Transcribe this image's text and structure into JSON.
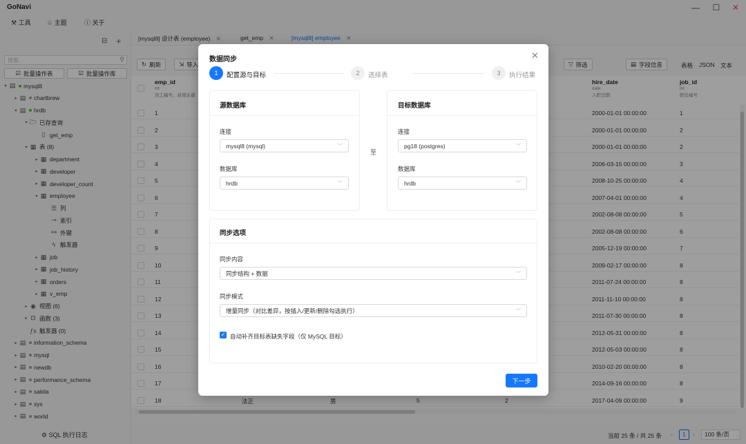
{
  "app": {
    "title": "GoNavi",
    "min": "—",
    "max": "☐",
    "close": "✕"
  },
  "menu": {
    "tools": "工具",
    "theme": "主题",
    "about": "关于"
  },
  "sidebar": {
    "search_placeholder": "搜索...",
    "batch_table": "批量操作表",
    "batch_db": "批量操作库",
    "tree": [
      {
        "label": "mysql8",
        "level": 0,
        "icon": "database-icon",
        "dot": "green",
        "arrow": "▾"
      },
      {
        "label": "chartbrew",
        "level": 1,
        "icon": "database-icon",
        "dot": "grey",
        "arrow": "▸"
      },
      {
        "label": "hrdb",
        "level": 1,
        "icon": "database-icon",
        "dot": "green",
        "arrow": "▾"
      },
      {
        "label": "已存查询",
        "level": 2,
        "icon": "folder-icon",
        "arrow": "▾"
      },
      {
        "label": "get_emp",
        "level": 3,
        "icon": "file-icon",
        "arrow": ""
      },
      {
        "label": "表 (8)",
        "level": 2,
        "icon": "table-icon",
        "arrow": "▾"
      },
      {
        "label": "department",
        "level": 3,
        "icon": "table-icon",
        "arrow": "▸"
      },
      {
        "label": "developer",
        "level": 3,
        "icon": "table-icon",
        "arrow": "▸"
      },
      {
        "label": "developer_count",
        "level": 3,
        "icon": "table-icon",
        "arrow": "▸"
      },
      {
        "label": "employee",
        "level": 3,
        "icon": "table-icon",
        "arrow": "▾"
      },
      {
        "label": "列",
        "level": 4,
        "icon": "list-icon",
        "arrow": ""
      },
      {
        "label": "索引",
        "level": 4,
        "icon": "key-icon",
        "arrow": ""
      },
      {
        "label": "外键",
        "level": 4,
        "icon": "link-icon",
        "arrow": ""
      },
      {
        "label": "触发器",
        "level": 4,
        "icon": "bolt-icon",
        "arrow": ""
      },
      {
        "label": "job",
        "level": 3,
        "icon": "table-icon",
        "arrow": "▸"
      },
      {
        "label": "job_history",
        "level": 3,
        "icon": "table-icon",
        "arrow": "▸"
      },
      {
        "label": "orders",
        "level": 3,
        "icon": "table-icon",
        "arrow": "▸"
      },
      {
        "label": "v_emp",
        "level": 3,
        "icon": "table-icon",
        "arrow": "▸"
      },
      {
        "label": "视图 (6)",
        "level": 2,
        "icon": "eye-icon",
        "arrow": "▸"
      },
      {
        "label": "函数 (3)",
        "level": 2,
        "icon": "function-icon",
        "arrow": "▸"
      },
      {
        "label": "触发器 (0)",
        "level": 2,
        "icon": "fx-icon",
        "arrow": ""
      },
      {
        "label": "information_schema",
        "level": 1,
        "icon": "database-icon",
        "dot": "grey",
        "arrow": "▸"
      },
      {
        "label": "mysql",
        "level": 1,
        "icon": "database-icon",
        "dot": "grey",
        "arrow": "▸"
      },
      {
        "label": "newdb",
        "level": 1,
        "icon": "database-icon",
        "dot": "grey",
        "arrow": "▸"
      },
      {
        "label": "performance_schema",
        "level": 1,
        "icon": "database-icon",
        "dot": "grey",
        "arrow": "▸"
      },
      {
        "label": "sakila",
        "level": 1,
        "icon": "database-icon",
        "dot": "grey",
        "arrow": "▸"
      },
      {
        "label": "sys",
        "level": 1,
        "icon": "database-icon",
        "dot": "grey",
        "arrow": "▸"
      },
      {
        "label": "world",
        "level": 1,
        "icon": "database-icon",
        "dot": "grey",
        "arrow": "▸"
      }
    ],
    "sql_log": "SQL 执行日志"
  },
  "tabs": [
    {
      "label": "[mysql8] 设计表 (employee)",
      "active": false
    },
    {
      "label": "get_emp",
      "active": false
    },
    {
      "label": "[mysql8] employee",
      "active": true
    }
  ],
  "toolbar": {
    "refresh": "刷新",
    "import": "导入",
    "filter": "筛选",
    "field_info": "字段信息",
    "view_table": "表格",
    "view_json": "JSON",
    "view_text": "文本"
  },
  "grid": {
    "col_emp_id": {
      "name": "emp_id",
      "type": "int",
      "comment": "员工编号，自增主键"
    },
    "col_hire_date": {
      "name": "hire_date",
      "type": "date",
      "comment": "入职日期"
    },
    "col_job_id": {
      "name": "job_id",
      "type": "int",
      "comment": "职位编号"
    },
    "rows": [
      {
        "id": "1",
        "hire": "2000-01-01 00:00:00",
        "job": "1"
      },
      {
        "id": "2",
        "hire": "2000-01-01 00:00:00",
        "job": "2"
      },
      {
        "id": "3",
        "hire": "2000-01-01 00:00:00",
        "job": "2"
      },
      {
        "id": "4",
        "hire": "2006-03-15 00:00:00",
        "job": "3"
      },
      {
        "id": "5",
        "hire": "2008-10-25 00:00:00",
        "job": "4"
      },
      {
        "id": "6",
        "hire": "2007-04-01 00:00:00",
        "job": "4"
      },
      {
        "id": "7",
        "hire": "2002-08-08 00:00:00",
        "job": "5"
      },
      {
        "id": "8",
        "hire": "2002-08-08 00:00:00",
        "job": "6"
      },
      {
        "id": "9",
        "hire": "2005-12-19 00:00:00",
        "job": "7"
      },
      {
        "id": "10",
        "hire": "2009-02-17 00:00:00",
        "job": "8"
      },
      {
        "id": "11",
        "hire": "2011-07-24 00:00:00",
        "job": "8"
      },
      {
        "id": "12",
        "hire": "2011-11-10 00:00:00",
        "job": "8"
      },
      {
        "id": "13",
        "hire": "2011-07-30 00:00:00",
        "job": "8"
      },
      {
        "id": "14",
        "hire": "2012-05-31 00:00:00",
        "job": "8"
      },
      {
        "id": "15",
        "hire": "2012-05-03 00:00:00",
        "job": "8"
      },
      {
        "id": "16",
        "hire": "2010-02-20 00:00:00",
        "job": "8"
      },
      {
        "id": "17",
        "hire": "2014-09-16 00:00:00",
        "job": "8"
      },
      {
        "id": "18",
        "hire": "2017-04-09 00:00:00",
        "job": "9",
        "extra": [
          "法正",
          "男",
          "5",
          "2"
        ]
      }
    ]
  },
  "footer": {
    "summary": "当前 25 条 / 共 25 条",
    "page": "1",
    "page_size": "100 条/页"
  },
  "modal": {
    "title": "数据同步",
    "steps": [
      {
        "num": "1",
        "label": "配置源与目标",
        "active": true
      },
      {
        "num": "2",
        "label": "选择表",
        "active": false
      },
      {
        "num": "3",
        "label": "执行结果",
        "active": false
      }
    ],
    "source": {
      "heading": "源数据库",
      "conn_label": "连接",
      "conn_value": "mysql8 (mysql)",
      "db_label": "数据库",
      "db_value": "hrdb"
    },
    "to_label": "至",
    "target": {
      "heading": "目标数据库",
      "conn_label": "连接",
      "conn_value": "pg18 (postgres)",
      "db_label": "数据库",
      "db_value": "hrdb"
    },
    "options": {
      "heading": "同步选项",
      "content_label": "同步内容",
      "content_value": "同步结构 + 数据",
      "mode_label": "同步模式",
      "mode_value": "增量同步（对比差异，按插入/更新/删除勾选执行）",
      "auto_fill": "自动补齐目标表缺失字段（仅 MySQL 目标）",
      "auto_fill_checked": true
    },
    "next": "下一步"
  },
  "colors": {
    "accent": "#1677ff",
    "green": "#52c41a"
  }
}
